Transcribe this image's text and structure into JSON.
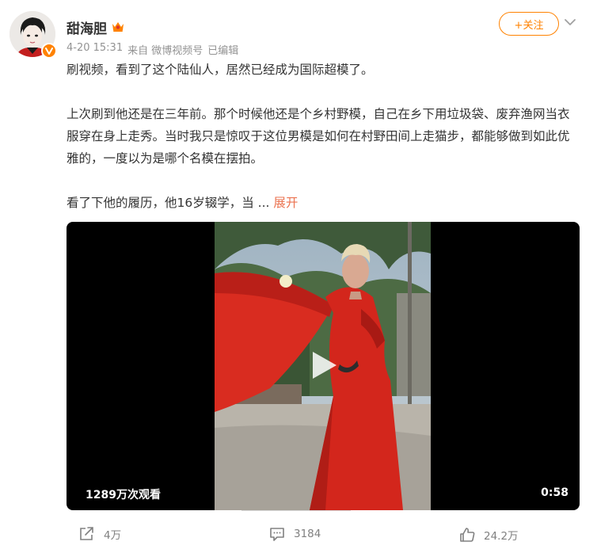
{
  "user": {
    "name": "甜海胆",
    "badge_icon": "crown-badge-icon",
    "verified_icon": "v-verified-icon"
  },
  "meta": {
    "date": "4-20 15:31",
    "source": "来自 微博视频号",
    "edited": "已编辑"
  },
  "follow": {
    "label": "+关注"
  },
  "more_icon": "chevron-down-icon",
  "post": {
    "line1": "刷视频，看到了这个陆仙人，居然已经成为国际超模了。",
    "para2": "上次刷到他还是在三年前。那个时候他还是个乡村野模，自己在乡下用垃圾袋、废弃渔网当衣服穿在身上走秀。当时我只是惊叹于这位男模是如何在村野田间上走猫步，都能够做到如此优雅的，一度以为是哪个名模在摆拍。",
    "para3": "看了下他的履历，他16岁辍学，当",
    "ellipsis": " ... ",
    "expand": "展开"
  },
  "video": {
    "views": "1289万次观看",
    "duration": "0:58",
    "play_icon": "play-icon"
  },
  "actions": {
    "share": {
      "icon": "share-icon",
      "count": "4万"
    },
    "comment": {
      "icon": "comment-icon",
      "count": "3184"
    },
    "like": {
      "icon": "thumbs-up-icon",
      "count": "24.2万"
    }
  },
  "colors": {
    "accent": "#ff8200",
    "link": "#eb7350",
    "text": "#333333",
    "meta": "#939393"
  }
}
